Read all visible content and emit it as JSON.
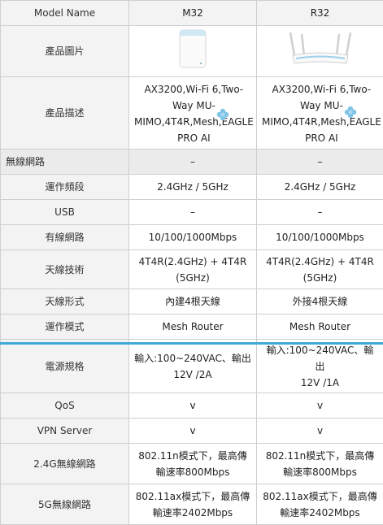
{
  "header": {
    "label": "Model Name",
    "m32": "M32",
    "r32": "R32"
  },
  "rows": {
    "image": {
      "label": "產品圖片"
    },
    "desc": {
      "label": "產品描述",
      "m32": [
        "AX3200,Wi-Fi 6,Two-",
        "Way MU-",
        "MIMO,4T4R,Mesh,EAGLE",
        "PRO AI"
      ],
      "r32": [
        "AX3200,Wi-Fi 6,Two-",
        "Way MU-",
        "MIMO,4T4R,Mesh,EAGLE",
        "PRO AI"
      ]
    },
    "wireless": {
      "label": "無線網路",
      "m32": "–",
      "r32": "–"
    },
    "band": {
      "label": "運作頻段",
      "m32": "2.4GHz / 5GHz",
      "r32": "2.4GHz / 5GHz"
    },
    "usb": {
      "label": "USB",
      "m32": "–",
      "r32": "–"
    },
    "wired": {
      "label": "有線網路",
      "m32": "10/100/1000Mbps",
      "r32": "10/100/1000Mbps"
    },
    "antenna_tech": {
      "label": "天線技術",
      "m32": [
        "4T4R(2.4GHz) + 4T4R",
        "(5GHz)"
      ],
      "r32": [
        "4T4R(2.4GHz) + 4T4R",
        "(5GHz)"
      ]
    },
    "antenna_type": {
      "label": "天線形式",
      "m32": "內建4根天線",
      "r32": "外接4根天線"
    },
    "mode": {
      "label": "運作模式",
      "m32": "Mesh Router",
      "r32": "Mesh Router"
    },
    "power": {
      "label": "電源規格",
      "m32": [
        "輸入:100~240VAC、輸出",
        "12V /2A"
      ],
      "r32": [
        "輸入:100~240VAC、輸出",
        "12V /1A"
      ]
    },
    "qos": {
      "label": "QoS",
      "m32": "v",
      "r32": "v"
    },
    "vpn": {
      "label": "VPN Server",
      "m32": "v",
      "r32": "v"
    },
    "wifi24": {
      "label": "2.4G無線網路",
      "m32": [
        "802.11n模式下，最高傳",
        "輸速率800Mbps"
      ],
      "r32": [
        "802.11n模式下，最高傳",
        "輸速率800Mbps"
      ]
    },
    "wifi5": {
      "label": "5G無線網路",
      "m32": [
        "802.11ax模式下，最高傳",
        "輸速率2402Mbps"
      ],
      "r32": [
        "802.11ax模式下，最高傳",
        "輸速率2402Mbps"
      ]
    }
  },
  "colors": {
    "accent_line": "#3fa9d6",
    "header_bg": "#f3f3f3",
    "border": "#cfcfcf",
    "flower": "#7fc4e6"
  }
}
